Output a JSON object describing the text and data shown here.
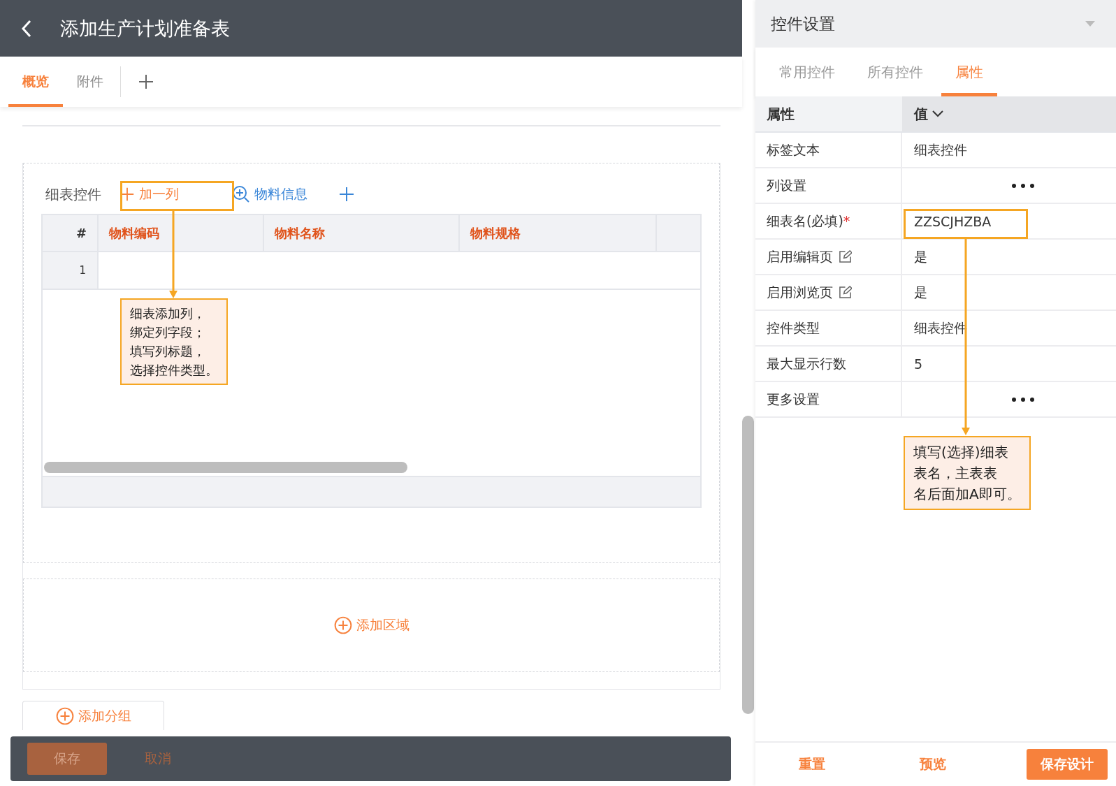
{
  "header": {
    "title": "添加生产计划准备表"
  },
  "tabs": [
    {
      "label": "概览",
      "selected": true
    },
    {
      "label": "附件",
      "selected": false
    }
  ],
  "detail_table": {
    "label": "细表控件",
    "add_column": "加一列",
    "lookup": "物料信息",
    "columns": [
      "#",
      "物料编码",
      "物料名称",
      "物料规格"
    ],
    "rows": [
      {
        "index": "1"
      }
    ]
  },
  "add_area": "添加区域",
  "add_group": "添加分组",
  "bottom_bar": [
    {
      "label": "保存",
      "kind": "primary"
    },
    {
      "label": "取消",
      "kind": "text"
    }
  ],
  "panel": {
    "title": "控件设置",
    "tabs": [
      {
        "label": "常用控件",
        "selected": false
      },
      {
        "label": "所有控件",
        "selected": false
      },
      {
        "label": "属性",
        "selected": true
      }
    ],
    "columns": [
      "属性",
      "值"
    ],
    "properties": [
      {
        "name": "标签文本",
        "kind": "text",
        "value": "细表控件",
        "editable": false
      },
      {
        "name": "列设置",
        "kind": "more",
        "editable": false
      },
      {
        "name": "细表名(必填)",
        "kind": "text",
        "value": "ZZSCJHZBA",
        "required_mark": "*",
        "editable": false
      },
      {
        "name": "启用编辑页",
        "kind": "text",
        "value": "是",
        "editable": true
      },
      {
        "name": "启用浏览页",
        "kind": "text",
        "value": "是",
        "editable": true
      },
      {
        "name": "控件类型",
        "kind": "text",
        "value": "细表控件",
        "editable": false
      },
      {
        "name": "最大显示行数",
        "kind": "text",
        "value": "5",
        "editable": false
      },
      {
        "name": "更多设置",
        "kind": "more",
        "editable": false
      }
    ],
    "footer": [
      {
        "label": "重置",
        "kind": "text"
      },
      {
        "label": "预览",
        "kind": "text"
      },
      {
        "label": "保存设计",
        "kind": "primary"
      }
    ]
  },
  "annotations": [
    {
      "lines": [
        "细表添加列，",
        "绑定列字段；",
        "填写列标题，",
        "选择控件类型。"
      ]
    },
    {
      "lines": [
        "填写(选择)细表",
        "表名，主表表",
        "名后面加A即可。"
      ]
    }
  ]
}
